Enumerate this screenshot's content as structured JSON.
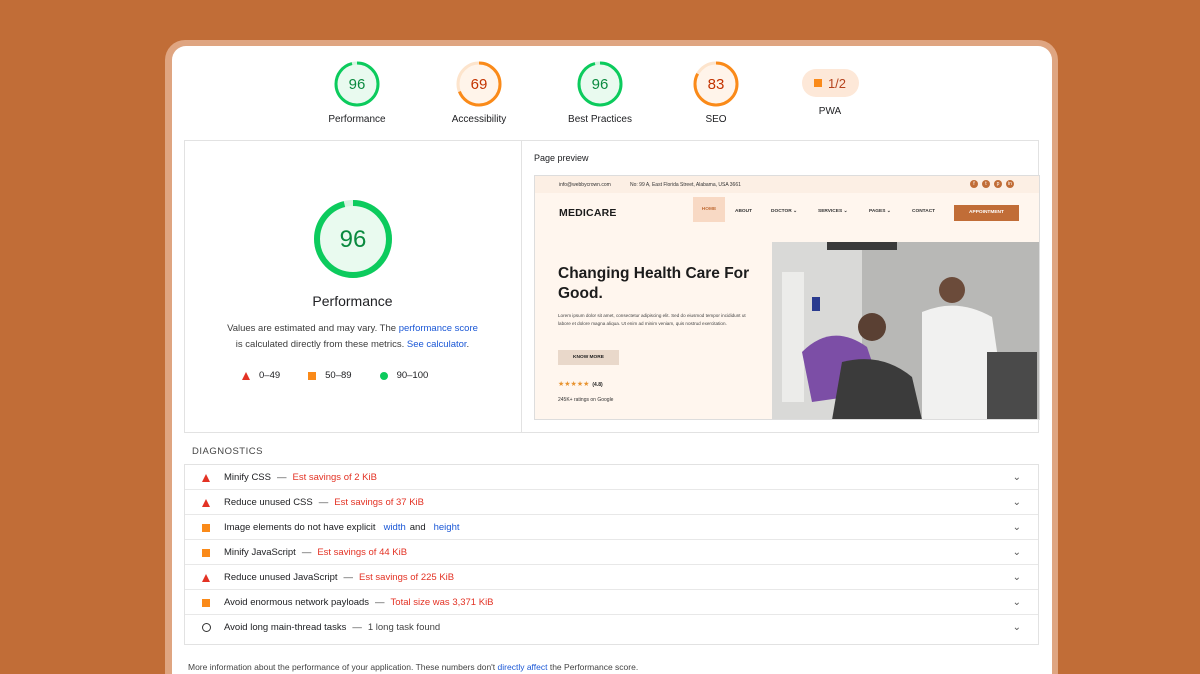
{
  "gauges": [
    {
      "value": "96",
      "label": "Performance",
      "color": "#0ccb5d",
      "fill": 0.96
    },
    {
      "value": "69",
      "label": "Accessibility",
      "color": "#fa8a19",
      "fill": 0.69
    },
    {
      "value": "96",
      "label": "Best Practices",
      "color": "#0ccb5d",
      "fill": 0.96
    },
    {
      "value": "83",
      "label": "SEO",
      "color": "#fa8a19",
      "fill": 0.83
    }
  ],
  "pwa": {
    "value": "1/2",
    "label": "PWA"
  },
  "summary": {
    "score": "96",
    "score_fill": 0.96,
    "title": "Performance",
    "note_a": "Values are estimated and may vary. The",
    "note_link1": "performance score",
    "note_b": "is calculated directly from these metrics.",
    "note_link2": "See calculator",
    "note_c": ".",
    "legend": [
      "0–49",
      "50–89",
      "90–100"
    ]
  },
  "preview": {
    "title": "Page preview",
    "email": "info@webbycrown.com",
    "address": "No: 99 A, East Florida Street, Alabama, USA 3661",
    "social": [
      "f",
      "t",
      "p",
      "in"
    ],
    "logo": "MEDICARE",
    "nav": [
      "HOME",
      "ABOUT",
      "DOCTOR ⌄",
      "SERVICES ⌄",
      "PAGES ⌄",
      "CONTACT"
    ],
    "cta": "APPOINTMENT",
    "hero_title": "Changing Health Care For Good.",
    "hero_text": "Lorem ipsum dolor sit amet, consectetur adipiscing elit. Sed do eiusmod tempor incididunt ut labore et dolore magna aliqua. Ut enim ad minim veniam, quis nostrud exercitation.",
    "button": "KNOW MORE",
    "stars": "★★★★★",
    "rating": "(4.8)",
    "ratings_text": "245K+ ratings on Google"
  },
  "diagnostics": {
    "title": "DIAGNOSTICS",
    "rows": [
      {
        "icon": "fail",
        "text": "Minify CSS",
        "detail": "Est savings of 2 KiB"
      },
      {
        "icon": "fail",
        "text": "Reduce unused CSS",
        "detail": "Est savings of 37 KiB"
      },
      {
        "icon": "average",
        "text": "Image elements do not have explicit",
        "link1": "width",
        "mid": "and",
        "link2": "height"
      },
      {
        "icon": "average",
        "text": "Minify JavaScript",
        "detail": "Est savings of 44 KiB"
      },
      {
        "icon": "fail",
        "text": "Reduce unused JavaScript",
        "detail": "Est savings of 225 KiB"
      },
      {
        "icon": "average",
        "text": "Avoid enormous network payloads",
        "detail": "Total size was 3,371 KiB"
      },
      {
        "icon": "info",
        "text": "Avoid long main-thread tasks",
        "grey": "1 long task found"
      }
    ]
  },
  "footer": {
    "a": "More information about the performance of your application. These numbers don't",
    "link": "directly affect",
    "b": "the Performance score."
  }
}
